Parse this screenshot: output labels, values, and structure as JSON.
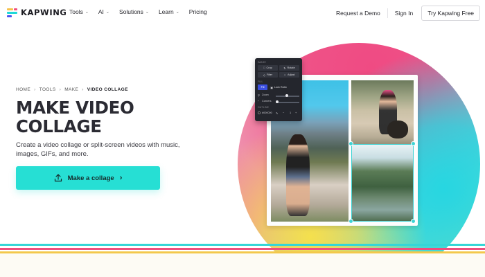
{
  "header": {
    "logo_text": "KAPWING",
    "nav": [
      {
        "label": "Tools",
        "has_menu": true
      },
      {
        "label": "AI",
        "has_menu": true
      },
      {
        "label": "Solutions",
        "has_menu": true
      },
      {
        "label": "Learn",
        "has_menu": true
      },
      {
        "label": "Pricing",
        "has_menu": false
      }
    ],
    "request_demo": "Request a Demo",
    "sign_in": "Sign In",
    "try_free": "Try Kapwing Free"
  },
  "breadcrumb": [
    "HOME",
    "TOOLS",
    "MAKE",
    "VIDEO COLLAGE"
  ],
  "hero": {
    "title": "MAKE VIDEO COLLAGE",
    "description": "Create a video collage or split-screen videos with music, images, GIFs, and more.",
    "cta_label": "Make a collage",
    "cta_icon": "upload-icon"
  },
  "editor_panel": {
    "section_labels": [
      "IMAGE",
      "FILL",
      "OUTLINE"
    ],
    "buttons": [
      "Crop",
      "Rotate",
      "Filter",
      "Adjust"
    ],
    "fill_buttons": [
      "Fill",
      "Lock Ratio"
    ],
    "sliders": [
      "Zoom",
      "Corners"
    ],
    "color_value": "#000000"
  },
  "colors": {
    "accent": "#26dfd4",
    "pink": "#ec4f7e",
    "yellow": "#f3c84b",
    "teal": "#35d6d6"
  }
}
